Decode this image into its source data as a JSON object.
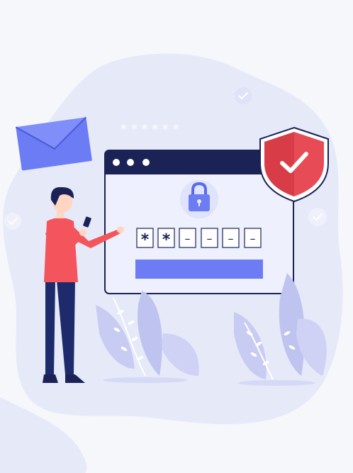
{
  "illustration": {
    "title": "",
    "password_mask": "* * * * * *",
    "password_fields": [
      {
        "char": "*"
      },
      {
        "char": "*"
      },
      {
        "char": "–"
      },
      {
        "char": "–"
      },
      {
        "char": "–"
      },
      {
        "char": "–"
      }
    ],
    "colors": {
      "background": "#f6f7fb",
      "blob": "#e6e9f8",
      "window_border": "#1b2356",
      "window_header": "#1b2356",
      "window_body": "#eef0fd",
      "accent_blue": "#6b7cf5",
      "shield_red": "#e74b55",
      "shirt_red": "#f4545b",
      "pants_navy": "#1d2a6b",
      "plant_lavender": "#c9ccf2"
    },
    "icons": [
      "envelope-icon",
      "padlock-icon",
      "shield-check-icon",
      "check-circle-icon",
      "person-figure",
      "plant-decoration"
    ]
  }
}
